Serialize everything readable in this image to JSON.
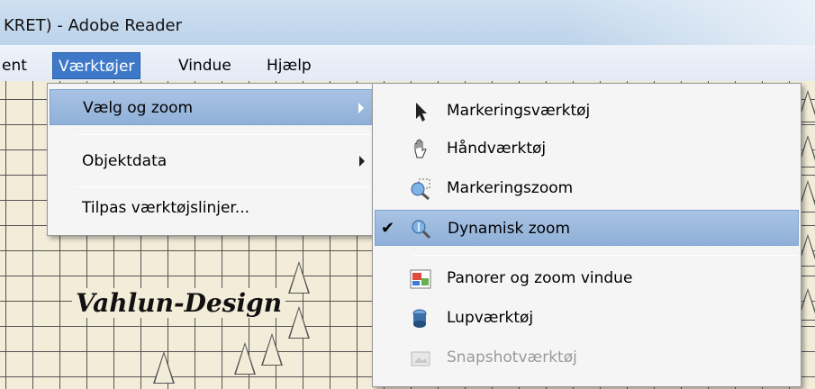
{
  "window": {
    "title": "KRET) - Adobe Reader"
  },
  "menubar": {
    "items": [
      {
        "label": "ent"
      },
      {
        "label": "Værktøjer"
      },
      {
        "label": "Vindue"
      },
      {
        "label": "Hjælp"
      }
    ]
  },
  "tools_menu": {
    "items": [
      {
        "label": "Vælg og zoom"
      },
      {
        "label": "Objektdata"
      },
      {
        "label": "Tilpas værktøjslinjer..."
      }
    ]
  },
  "zoom_submenu": {
    "items": [
      {
        "label": "Markeringsværktøj",
        "icon": "arrow-cursor-icon"
      },
      {
        "label": "Håndværktøj",
        "icon": "hand-icon"
      },
      {
        "label": "Markeringszoom",
        "icon": "marquee-zoom-icon"
      },
      {
        "label": "Dynamisk zoom",
        "icon": "dynamic-zoom-icon",
        "checked": true
      },
      {
        "label": "Panorer og zoom vindue",
        "icon": "pan-zoom-window-icon"
      },
      {
        "label": "Lupværktøj",
        "icon": "loupe-icon"
      },
      {
        "label": "Snapshotværktøj",
        "icon": "snapshot-icon",
        "disabled": true
      }
    ]
  },
  "document": {
    "logo_text": "Vahlun-Design"
  },
  "colors": {
    "menu_highlight": "#3d79c8",
    "submenu_highlight": "#a8c3e4",
    "titlebar": "#c6dbef"
  }
}
